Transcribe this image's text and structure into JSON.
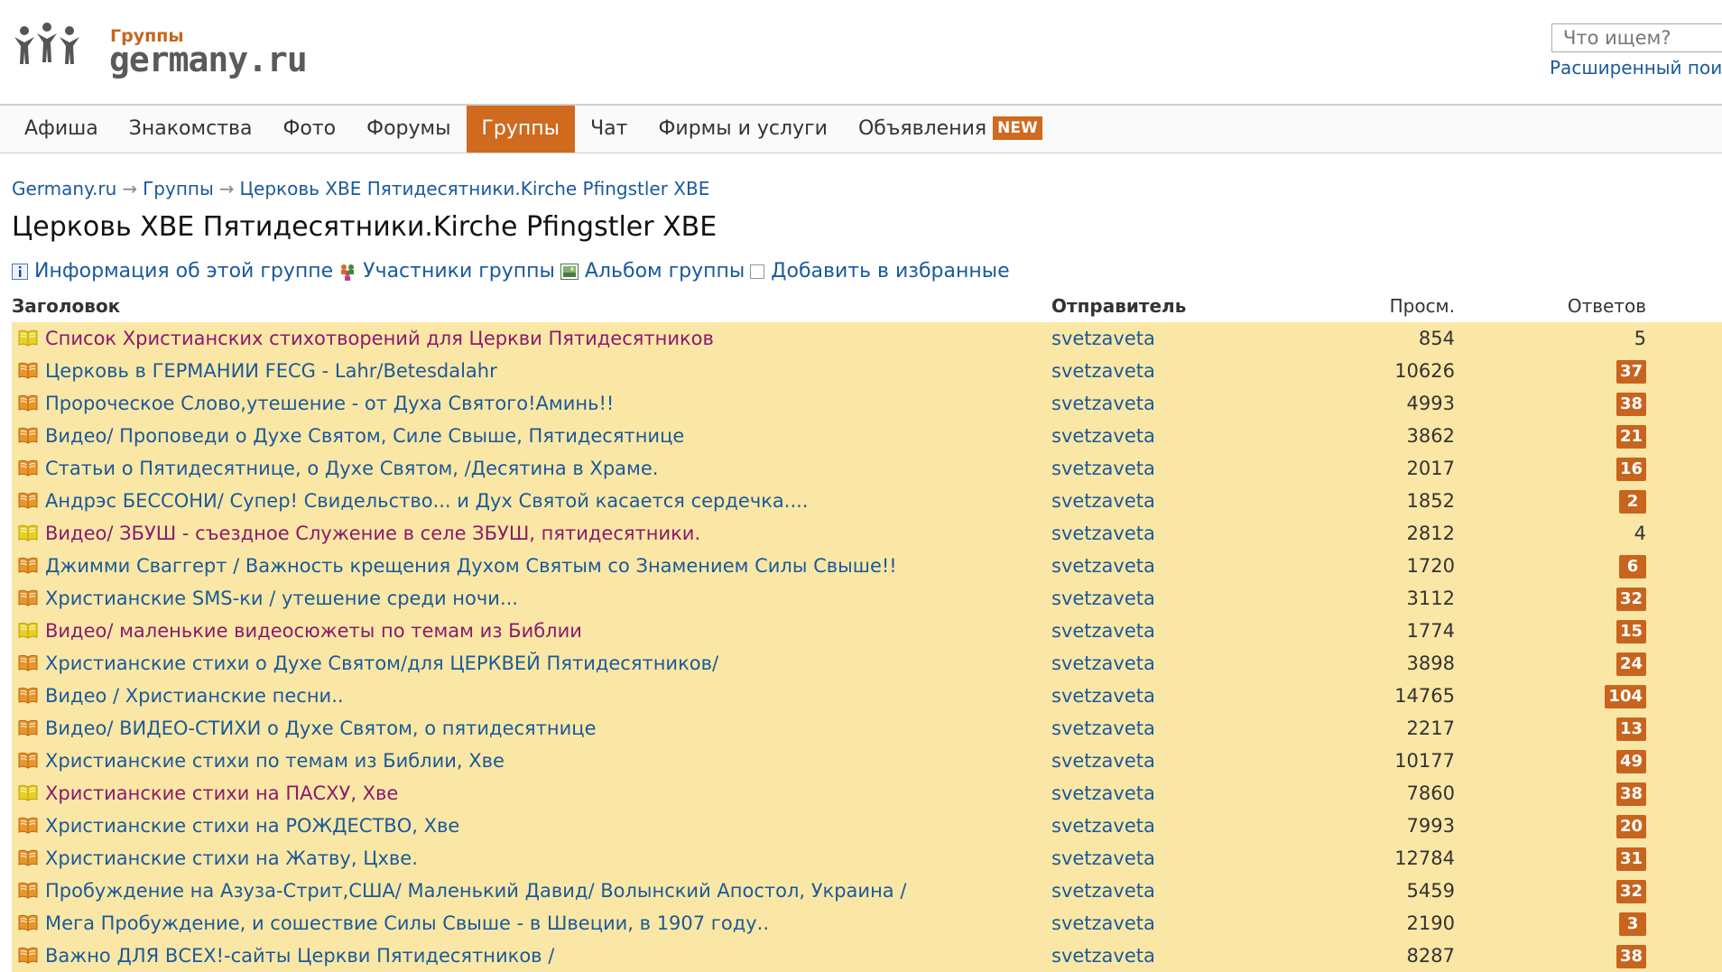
{
  "logo": {
    "subtitle": "Группы",
    "name": "germany.ru"
  },
  "search": {
    "placeholder": "Что ищем?",
    "advanced_link": "Расширенный поиск"
  },
  "nav": [
    {
      "label": "Афиша",
      "active": false
    },
    {
      "label": "Знакомства",
      "active": false
    },
    {
      "label": "Фото",
      "active": false
    },
    {
      "label": "Форумы",
      "active": false
    },
    {
      "label": "Группы",
      "active": true
    },
    {
      "label": "Чат",
      "active": false
    },
    {
      "label": "Фирмы и услуги",
      "active": false
    },
    {
      "label": "Объявления",
      "active": false,
      "badge": "NEW"
    }
  ],
  "breadcrumb": [
    "Germany.ru",
    "Группы",
    "Церковь ХВЕ Пятидесятники.Kirche Pfingstler XBE"
  ],
  "breadcrumb_separator": "→",
  "page_title": "Церковь ХВЕ Пятидесятники.Kirche Pfingstler XBE",
  "actions": [
    {
      "label": "Информация об этой группе",
      "icon": "info-icon"
    },
    {
      "label": "Участники группы",
      "icon": "members-icon"
    },
    {
      "label": "Альбом группы",
      "icon": "album-icon"
    },
    {
      "label": "Добавить в избранные",
      "icon": "checkbox-icon"
    }
  ],
  "table": {
    "headers": {
      "title": "Заголовок",
      "sender": "Отправитель",
      "views": "Просм.",
      "replies": "Ответов"
    },
    "rows": [
      {
        "title": "Список Христианских стихотворений для Церкви Пятидесятников",
        "sender": "svetzaveta",
        "views": "854",
        "replies": "5",
        "badge": false,
        "visited": true
      },
      {
        "title": "Церковь в ГЕРМАНИИ FECG - Lahr/Betesdalahr",
        "sender": "svetzaveta",
        "views": "10626",
        "replies": "37",
        "badge": true,
        "visited": false
      },
      {
        "title": "Пророческое Слово,утешение - от Духа Святого!Аминь!!",
        "sender": "svetzaveta",
        "views": "4993",
        "replies": "38",
        "badge": true,
        "visited": false
      },
      {
        "title": "Видео/ Проповеди о Духе Святом, Силе Свыше, Пятидесятнице",
        "sender": "svetzaveta",
        "views": "3862",
        "replies": "21",
        "badge": true,
        "visited": false
      },
      {
        "title": "Статьи о Пятидесятнице, о Духе Святом, /Десятина в Храме.",
        "sender": "svetzaveta",
        "views": "2017",
        "replies": "16",
        "badge": true,
        "visited": false
      },
      {
        "title": "Андрэс БЕССОНИ/ Супер! Свидельство... и Дух Святой касается сердечка....",
        "sender": "svetzaveta",
        "views": "1852",
        "replies": "2",
        "badge": true,
        "visited": false
      },
      {
        "title": "Видео/ ЗБУШ - съездное Служение в селе ЗБУШ, пятидесятники.",
        "sender": "svetzaveta",
        "views": "2812",
        "replies": "4",
        "badge": false,
        "visited": true
      },
      {
        "title": "Джимми Сваггерт / Важность крещения Духом Святым со Знамением Силы Свыше!!",
        "sender": "svetzaveta",
        "views": "1720",
        "replies": "6",
        "badge": true,
        "visited": false
      },
      {
        "title": "Христианские SMS-ки / утешение среди ночи...",
        "sender": "svetzaveta",
        "views": "3112",
        "replies": "32",
        "badge": true,
        "visited": false
      },
      {
        "title": "Видео/ маленькие видеосюжеты по темам из Библии",
        "sender": "svetzaveta",
        "views": "1774",
        "replies": "15",
        "badge": true,
        "visited": true
      },
      {
        "title": "Христианские стихи о Духе Святом/для ЦЕРКВЕЙ Пятидесятников/",
        "sender": "svetzaveta",
        "views": "3898",
        "replies": "24",
        "badge": true,
        "visited": false
      },
      {
        "title": "Видео / Христианские песни..",
        "sender": "svetzaveta",
        "views": "14765",
        "replies": "104",
        "badge": true,
        "visited": false
      },
      {
        "title": "Видео/ ВИДЕО-СТИХИ о Духе Святом, о пятидесятнице",
        "sender": "svetzaveta",
        "views": "2217",
        "replies": "13",
        "badge": true,
        "visited": false
      },
      {
        "title": "Христианские стихи по темам из Библии, Хве",
        "sender": "svetzaveta",
        "views": "10177",
        "replies": "49",
        "badge": true,
        "visited": false
      },
      {
        "title": "Христианские стихи на ПАСХУ, Хве",
        "sender": "svetzaveta",
        "views": "7860",
        "replies": "38",
        "badge": true,
        "visited": true
      },
      {
        "title": "Христианские стихи на РОЖДЕСТВО, Хве",
        "sender": "svetzaveta",
        "views": "7993",
        "replies": "20",
        "badge": true,
        "visited": false
      },
      {
        "title": "Христианские стихи на Жатву, Цхве.",
        "sender": "svetzaveta",
        "views": "12784",
        "replies": "31",
        "badge": true,
        "visited": false
      },
      {
        "title": "Пробуждение на Азуза-Стрит,США/ Маленький Давид/ Волынский Апостол, Украина /",
        "sender": "svetzaveta",
        "views": "5459",
        "replies": "32",
        "badge": true,
        "visited": false
      },
      {
        "title": "Мега Пробуждение, и сошествие Силы Свыше - в Швеции, в 1907 году..",
        "sender": "svetzaveta",
        "views": "2190",
        "replies": "3",
        "badge": true,
        "visited": false
      },
      {
        "title": "Важно ДЛЯ ВСЕХ!-сайты Церкви Пятидесятников /",
        "sender": "svetzaveta",
        "views": "8287",
        "replies": "38",
        "badge": true,
        "visited": false
      }
    ]
  },
  "colors": {
    "accent": "#cf6a1f",
    "link": "#1a5a9a",
    "visited": "#8a1a6e",
    "row_bg": "#fbe7a5"
  }
}
